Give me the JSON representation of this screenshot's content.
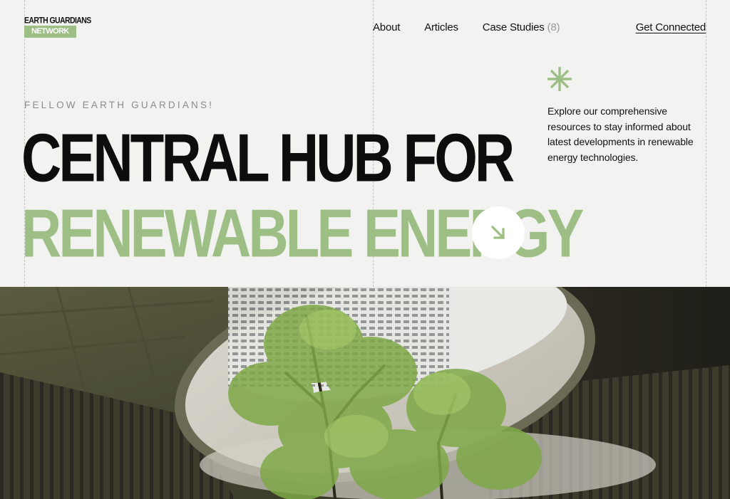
{
  "brand": {
    "logo_line1": "EARTH GUARDIANS",
    "logo_line2": "NETWORK"
  },
  "nav": {
    "about": "About",
    "articles": "Articles",
    "case_studies": "Case Studies",
    "case_studies_count": "(8)",
    "cta": "Get Connected"
  },
  "hero": {
    "eyebrow": "FELLOW EARTH GUARDIANS!",
    "headline_line1": "CENTRAL HUB FOR",
    "headline_line2": "RENEWABLE ENERGY",
    "description": "Explore our comprehensive resources to stay informed about latest developments in renewable energy technologies."
  },
  "icons": {
    "arrow": "arrow-down-right-icon",
    "asterisk": "asterisk-icon"
  },
  "colors": {
    "background": "#f2f2f0",
    "accent_green": "#9dbf85",
    "text": "#111111",
    "muted": "#8c8c86"
  }
}
